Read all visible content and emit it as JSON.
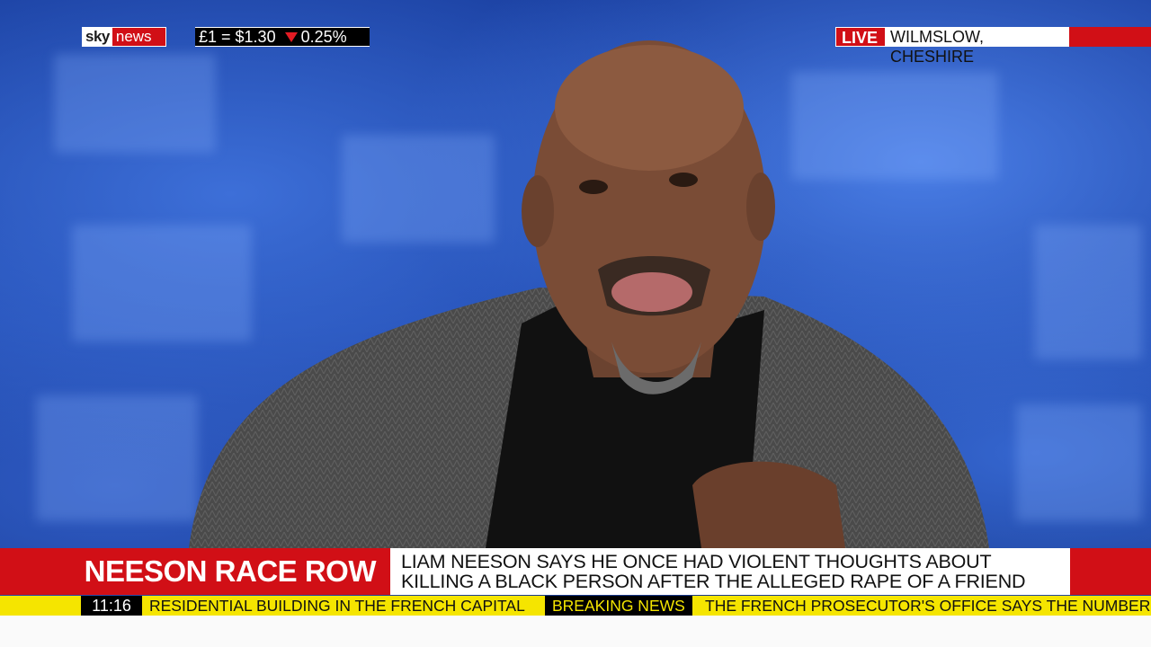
{
  "channel": {
    "logo_left": "sky",
    "logo_right": "news"
  },
  "fx": {
    "pair": "£1 = $1.30",
    "change": "0.25%",
    "direction": "down"
  },
  "live": {
    "tag": "LIVE",
    "location": "WILMSLOW, CHESHIRE"
  },
  "headline": {
    "topic": "NEESON RACE ROW",
    "line1": "LIAM NEESON SAYS HE ONCE HAD VIOLENT THOUGHTS ABOUT",
    "line2": "KILLING A BLACK PERSON AFTER THE ALLEGED RAPE OF A FRIEND"
  },
  "ticker": {
    "time": "11:16",
    "text1": "RESIDENTIAL BUILDING IN THE FRENCH CAPITAL",
    "breaking": "BREAKING NEWS",
    "text2": "THE FRENCH PROSECUTOR'S OFFICE SAYS THE NUMBER"
  },
  "colors": {
    "brand_red": "#d10f16",
    "ticker_yellow": "#f5e500"
  }
}
